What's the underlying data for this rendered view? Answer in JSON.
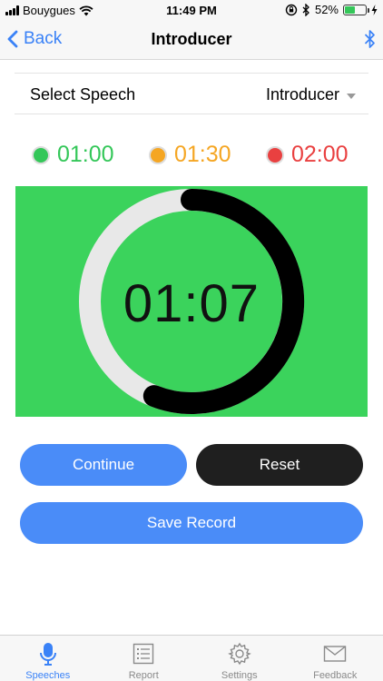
{
  "status_bar": {
    "carrier": "Bouygues",
    "time": "11:49 PM",
    "battery_text": "52%",
    "battery_level": 0.52,
    "icons": [
      "signal-icon",
      "wifi-icon",
      "rotation-lock-icon",
      "bluetooth-icon",
      "battery-icon",
      "charging-icon"
    ]
  },
  "nav": {
    "back_label": "Back",
    "title": "Introducer",
    "right_icon": "bluetooth-icon"
  },
  "select": {
    "label": "Select Speech",
    "value": "Introducer"
  },
  "milestones": [
    {
      "time": "01:00",
      "color": "#34c759"
    },
    {
      "time": "01:30",
      "color": "#f5a623"
    },
    {
      "time": "02:00",
      "color": "#e94040"
    }
  ],
  "timer": {
    "display": "01:07",
    "progress": 0.56,
    "background_color": "#3bd35c",
    "track_color": "#e8e8e8",
    "progress_color": "#000000"
  },
  "buttons": {
    "continue_label": "Continue",
    "reset_label": "Reset",
    "save_label": "Save Record"
  },
  "tabs": [
    {
      "label": "Speeches",
      "icon": "microphone-icon",
      "active": true
    },
    {
      "label": "Report",
      "icon": "list-icon",
      "active": false
    },
    {
      "label": "Settings",
      "icon": "gear-icon",
      "active": false
    },
    {
      "label": "Feedback",
      "icon": "envelope-icon",
      "active": false
    }
  ],
  "colors": {
    "accent": "#3a82f7",
    "button_blue": "#4a8cf8",
    "button_dark": "#1f1f1f"
  }
}
